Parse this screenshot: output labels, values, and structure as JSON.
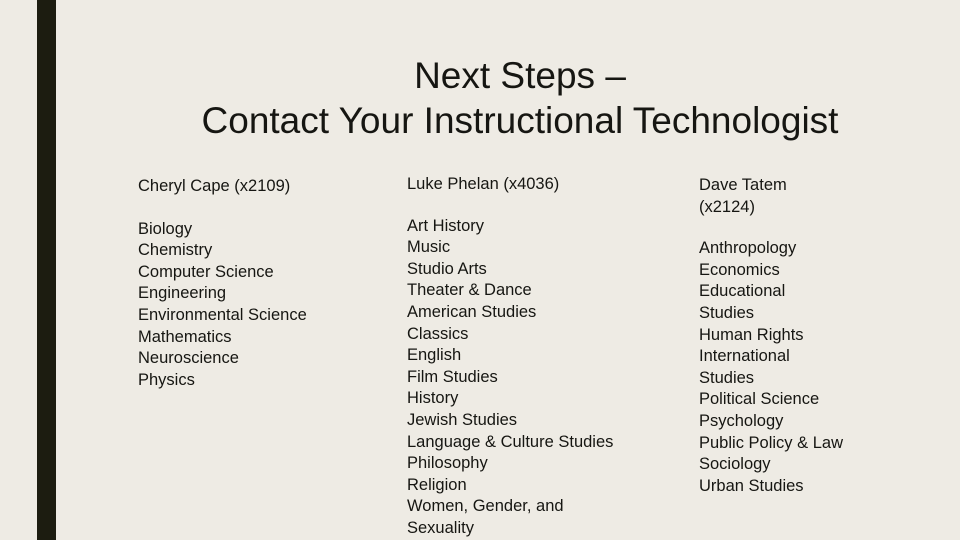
{
  "slide": {
    "title_line1": "Next Steps –",
    "title_line2": "Contact Your Instructional Technologist",
    "colors": {
      "background": "#eeebe4",
      "accent_bar": "#1c1c10",
      "text": "#161612"
    }
  },
  "columns": [
    {
      "contact": "Cheryl Cape  (x2109)",
      "departments": [
        "Biology",
        "Chemistry",
        "Computer Science",
        "Engineering",
        "Environmental Science",
        "Mathematics",
        "Neuroscience",
        "Physics"
      ]
    },
    {
      "contact": "Luke Phelan (x4036)",
      "departments": [
        "Art History",
        "Music",
        "Studio Arts",
        "Theater & Dance",
        "American Studies",
        "Classics",
        "English",
        "Film Studies",
        "History",
        "Jewish Studies",
        "Language & Culture Studies",
        "Philosophy",
        "Religion",
        "Women, Gender, and Sexuality"
      ]
    },
    {
      "contact": "Dave Tatem (x2124)",
      "departments": [
        "Anthropology",
        "Economics",
        "Educational Studies",
        "Human Rights",
        "International Studies",
        "Political Science",
        "Psychology",
        "Public Policy & Law",
        "Sociology",
        "Urban Studies"
      ]
    }
  ]
}
